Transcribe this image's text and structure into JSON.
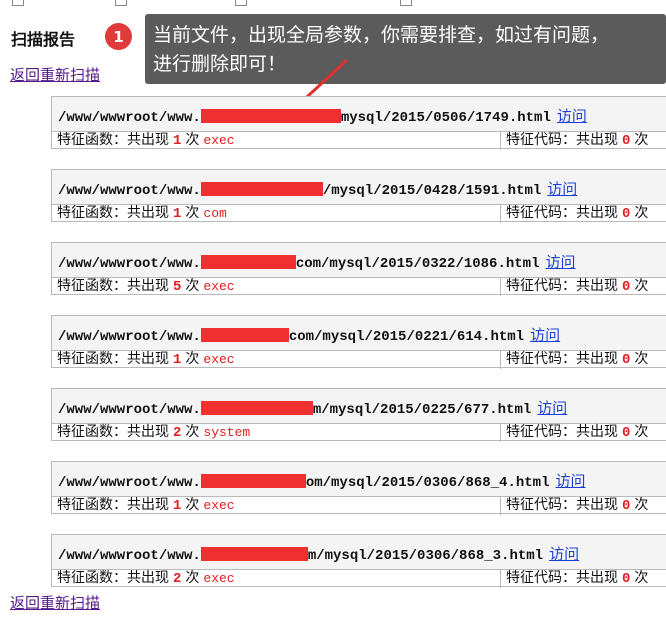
{
  "page": {
    "title": "扫描报告",
    "back_link_top": "返回重新扫描",
    "back_link_bottom": "返回重新扫描"
  },
  "annotation": {
    "badge_number": "1",
    "line1": "当前文件，出现全局参数，你需要排查，如过有问题，",
    "line2": "进行删除即可！",
    "bubble_color": "#5b5b5b",
    "accent": "#e03a3a"
  },
  "labels": {
    "feature_function": "特征函数：共出现",
    "feature_code": "特征代码：共出现",
    "times": "次",
    "visit": "访问"
  },
  "entries": [
    {
      "path_prefix": "/www/wwwroot/www.",
      "path_suffix": "mysql/2015/0506/1749.html",
      "fn_count": "1",
      "fn_name": "exec",
      "code_count": "0"
    },
    {
      "path_prefix": "/www/wwwroot/www.",
      "path_suffix": "/mysql/2015/0428/1591.html",
      "fn_count": "1",
      "fn_name": "com",
      "code_count": "0"
    },
    {
      "path_prefix": "/www/wwwroot/www.",
      "path_suffix": "com/mysql/2015/0322/1086.html",
      "fn_count": "5",
      "fn_name": "exec",
      "code_count": "0"
    },
    {
      "path_prefix": "/www/wwwroot/www.",
      "path_suffix": "com/mysql/2015/0221/614.html",
      "fn_count": "1",
      "fn_name": "exec",
      "code_count": "0"
    },
    {
      "path_prefix": "/www/wwwroot/www.",
      "path_suffix": "m/mysql/2015/0225/677.html",
      "fn_count": "2",
      "fn_name": "system",
      "code_count": "0"
    },
    {
      "path_prefix": "/www/wwwroot/www.",
      "path_suffix": "om/mysql/2015/0306/868_4.html",
      "fn_count": "1",
      "fn_name": "exec",
      "code_count": "0"
    },
    {
      "path_prefix": "/www/wwwroot/www.",
      "path_suffix": "m/mysql/2015/0306/868_3.html",
      "fn_count": "2",
      "fn_name": "exec",
      "code_count": "0"
    }
  ]
}
